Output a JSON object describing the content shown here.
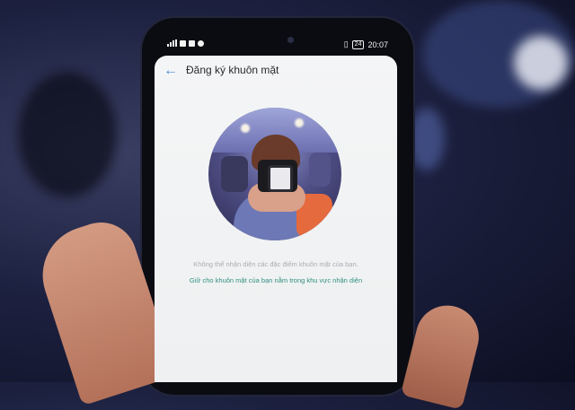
{
  "status_bar": {
    "time": "20:07",
    "battery": "24",
    "left_icons": [
      "signal-icon",
      "facebook-icon",
      "youtube-icon",
      "messenger-icon"
    ],
    "right_icons": [
      "vibrate-icon"
    ]
  },
  "app_bar": {
    "back_icon": "arrow-left-icon",
    "title": "Đăng ký khuôn mặt"
  },
  "messages": {
    "error": "Không thể nhận diện các đặc điểm khuôn mặt của bạn.",
    "hint": "Giữ cho khuôn mặt của bạn nằm trong khu vực nhận diện"
  },
  "colors": {
    "accent": "#4a8ad4",
    "hint_text": "#2f8f80",
    "error_text": "#a9aeb3"
  }
}
